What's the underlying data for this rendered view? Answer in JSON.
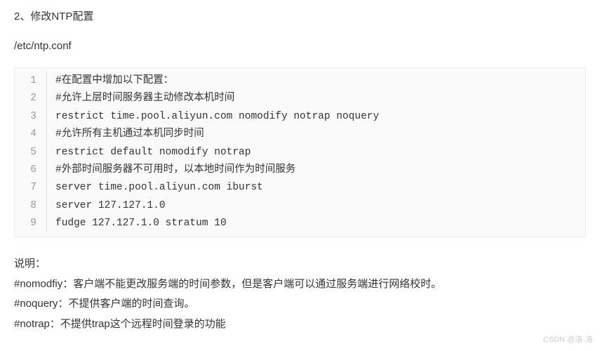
{
  "heading": "2、修改NTP配置",
  "filepath": "/etc/ntp.conf",
  "code_lines": [
    "#在配置中增加以下配置：",
    "#允许上层时间服务器主动修改本机时间",
    "restrict time.pool.aliyun.com nomodify notrap noquery",
    "#允许所有主机通过本机同步时间",
    "restrict default nomodify notrap",
    "#外部时间服务器不可用时，以本地时间作为时间服务",
    "server time.pool.aliyun.com iburst",
    "server 127.127.1.0",
    "fudge 127.127.1.0 stratum 10"
  ],
  "explain_title": "说明：",
  "explain_lines": [
    "#nomodfiy：客户端不能更改服务端的时间参数，但是客户端可以通过服务端进行网络校时。",
    "#noquery：不提供客户端的时间查询。",
    "#notrap：不提供trap这个远程时间登录的功能"
  ],
  "watermark": "CSDN @洛·洛"
}
